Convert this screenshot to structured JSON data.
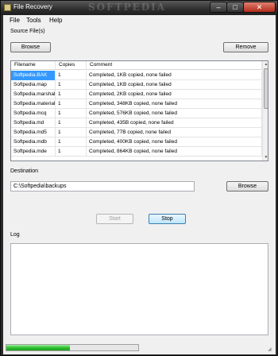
{
  "window": {
    "title": "File Recovery",
    "watermark": "SOFTPEDIA",
    "min_glyph": "–",
    "max_glyph": "□",
    "close_glyph": "✕"
  },
  "menu": [
    "File",
    "Tools",
    "Help"
  ],
  "source": {
    "label": "Source File(s)",
    "browse_label": "Browse",
    "remove_label": "Remove",
    "columns": [
      "Filename",
      "Copies",
      "Comment"
    ],
    "rows": [
      {
        "filename": "Softpedia.BAK",
        "copies": "1",
        "comment": "Completed, 1KB copied, none failed"
      },
      {
        "filename": "Softpedia.map",
        "copies": "1",
        "comment": "Completed, 1KB copied, none failed"
      },
      {
        "filename": "Softpedia.marshal",
        "copies": "1",
        "comment": "Completed, 2KB copied, none failed"
      },
      {
        "filename": "Softpedia.material",
        "copies": "1",
        "comment": "Completed, 348KB copied, none failed"
      },
      {
        "filename": "Softpedia.mcq",
        "copies": "1",
        "comment": "Completed, 576KB copied, none failed"
      },
      {
        "filename": "Softpedia.md",
        "copies": "1",
        "comment": "Completed, 435B copied, none failed"
      },
      {
        "filename": "Softpedia.md5",
        "copies": "1",
        "comment": "Completed, 77B copied, none failed"
      },
      {
        "filename": "Softpedia.mdb",
        "copies": "1",
        "comment": "Completed, 400KB copied, none failed"
      },
      {
        "filename": "Softpedia.mde",
        "copies": "1",
        "comment": "Completed, 864KB copied, none failed"
      }
    ],
    "selected_index": 0
  },
  "destination": {
    "label": "Destination",
    "path": "C:\\Softpedia\\backups",
    "browse_label": "Browse"
  },
  "actions": {
    "start_label": "Start",
    "stop_label": "Stop",
    "start_enabled": false
  },
  "log": {
    "label": "Log",
    "text": ""
  },
  "progress": {
    "fraction": 0.48
  },
  "colors": {
    "selection": "#3399ff",
    "progress": "#30c030",
    "close": "#c8382a"
  }
}
